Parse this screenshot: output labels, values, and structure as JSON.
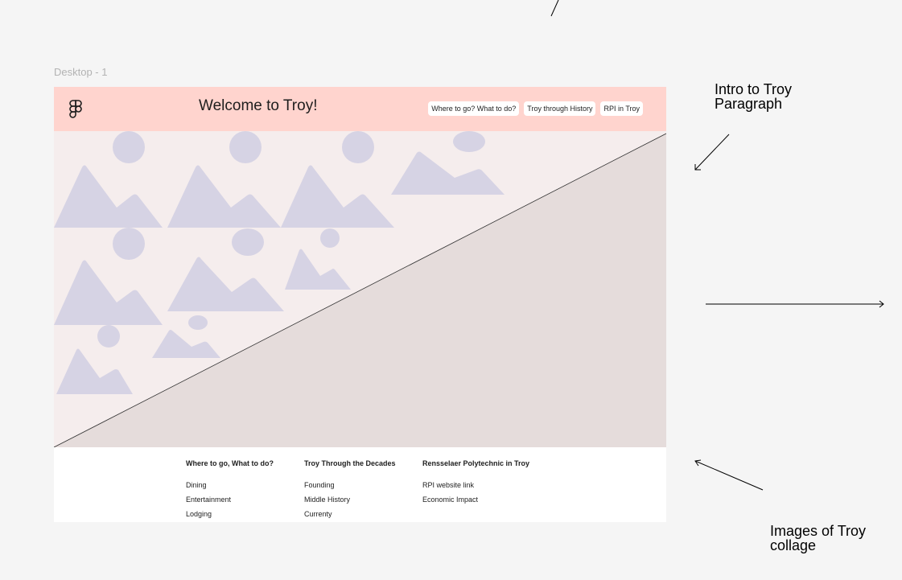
{
  "canvas": {
    "frame_label": "Desktop - 1"
  },
  "header": {
    "title": "Welcome to Troy!",
    "nav": [
      "Where to go? What to do?",
      "Troy through History",
      "RPI in Troy"
    ],
    "background": "#ffd4ce"
  },
  "hero": {
    "image_placeholder": "image-placeholder-icon",
    "background": "#f5eded",
    "diagonal_fill": "#e5dcdb",
    "placeholder_color": "#d6d3e4"
  },
  "footer": {
    "columns": [
      {
        "heading": "Where to go, What to do?",
        "links": [
          "Dining",
          "Entertainment",
          "Lodging"
        ]
      },
      {
        "heading": "Troy Through the Decades",
        "links": [
          "Founding",
          "Middle History",
          "Currenty"
        ]
      },
      {
        "heading": "Rensselaer Polytechnic in Troy",
        "links": [
          "RPI website link",
          "Economic Impact"
        ]
      }
    ]
  },
  "annotations": {
    "intro_note": "Intro to Troy Paragraph",
    "collage_note": "Images of Troy collage"
  }
}
